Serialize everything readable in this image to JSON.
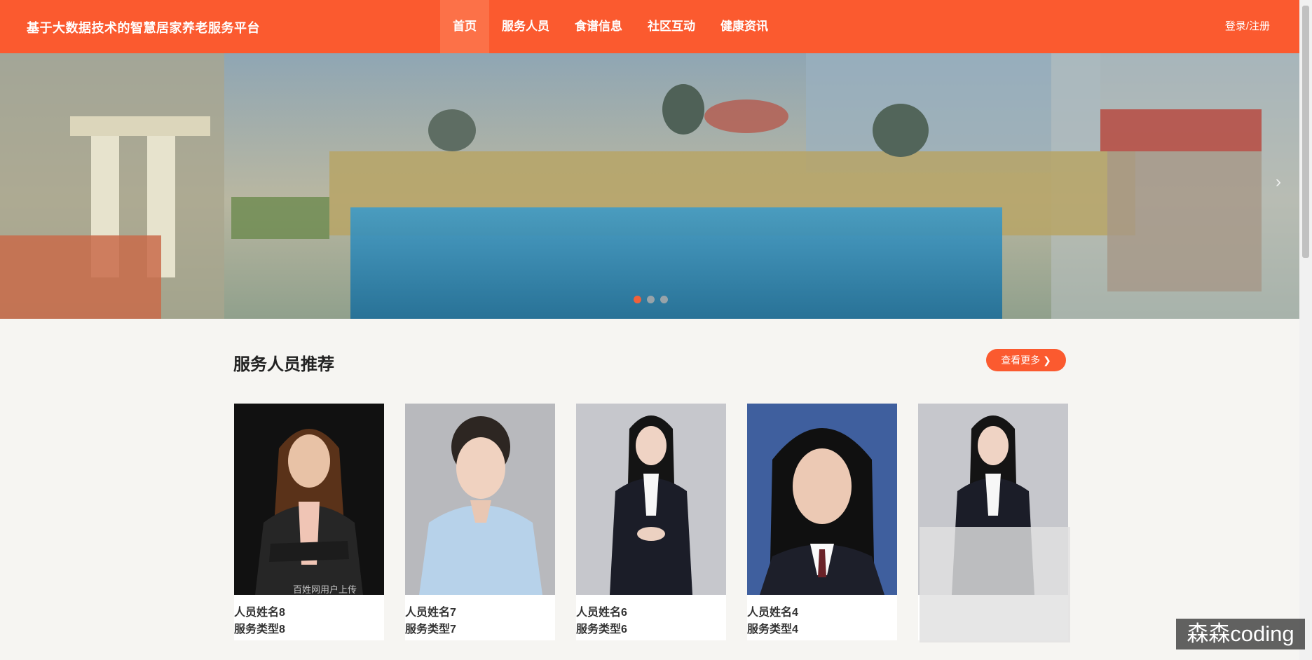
{
  "header": {
    "site_title": "基于大数据技术的智慧居家养老服务平台",
    "nav": [
      "首页",
      "服务人员",
      "食谱信息",
      "社区互动",
      "健康资讯"
    ],
    "active_nav": "首页",
    "login_label": "登录/注册"
  },
  "banner": {
    "slide_count": 3,
    "active_slide": 1,
    "next_icon": "chevron-right-icon"
  },
  "section": {
    "title": "服务人员推荐",
    "more_label": "查看更多",
    "more_icon": "chevron-right-icon"
  },
  "staff": [
    {
      "name": "人员姓名8",
      "type": "服务类型8",
      "photo_watermark": "百姓网用户上传"
    },
    {
      "name": "人员姓名7",
      "type": "服务类型7"
    },
    {
      "name": "人员姓名6",
      "type": "服务类型6"
    },
    {
      "name": "人员姓名4",
      "type": "服务类型4"
    },
    {
      "name": "",
      "type": ""
    }
  ],
  "overlay": {
    "watermark": "森森coding"
  },
  "colors": {
    "brand": "#fb5a2f",
    "nav_active": "#fc7148",
    "background": "#f6f5f2"
  }
}
